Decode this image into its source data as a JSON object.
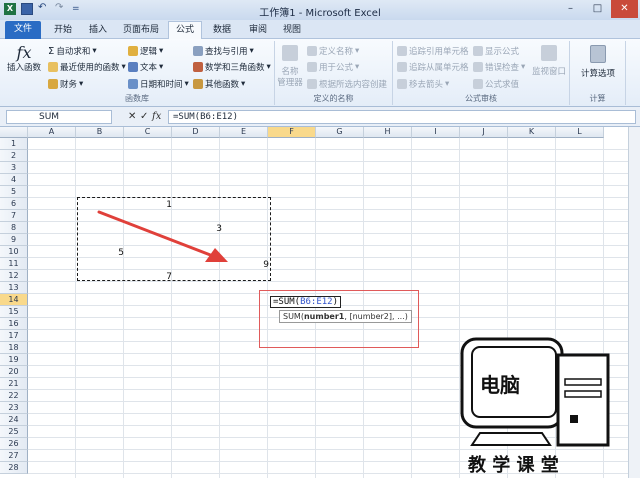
{
  "window": {
    "title": "工作簿1 - Microsoft Excel",
    "min": "–",
    "max": "□",
    "close": "✕",
    "quick_access": "="
  },
  "tabs": [
    "文件",
    "开始",
    "插入",
    "页面布局",
    "公式",
    "数据",
    "审阅",
    "视图"
  ],
  "ribbon": {
    "insert_function": "插入函数",
    "fx": "fx",
    "library": {
      "autosum": "自动求和",
      "recent": "最近使用的函数",
      "finance": "财务",
      "logic": "逻辑",
      "text": "文本",
      "datetime": "日期和时间",
      "lookup": "查找与引用",
      "math": "数学和三角函数",
      "other": "其他函数",
      "label": "函数库"
    },
    "names": {
      "manager_line1": "名称",
      "manager_line2": "管理器",
      "define": "定义名称",
      "use": "用于公式",
      "create": "根据所选内容创建",
      "label": "定义的名称"
    },
    "audit": {
      "trace_prec": "追踪引用单元格",
      "trace_dep": "追踪从属单元格",
      "remove": "移去箭头",
      "show": "显示公式",
      "check": "错误检查",
      "eval": "公式求值",
      "watch": "监视窗口",
      "label": "公式审核"
    },
    "calc": {
      "options": "计算选项",
      "label": "计算"
    }
  },
  "formula_bar": {
    "name_box": "SUM",
    "cancel": "✕",
    "enter": "✓",
    "fx": "fx",
    "formula": "=SUM(B6:E12)"
  },
  "columns": [
    "A",
    "B",
    "C",
    "D",
    "E",
    "F",
    "G",
    "H",
    "I",
    "J",
    "K",
    "L"
  ],
  "rows": [
    "1",
    "2",
    "3",
    "4",
    "5",
    "6",
    "7",
    "8",
    "9",
    "10",
    "11",
    "12",
    "13",
    "14",
    "15",
    "16",
    "17",
    "18",
    "19",
    "20",
    "21",
    "22",
    "23",
    "24",
    "25",
    "26",
    "27",
    "28"
  ],
  "cells": {
    "d6": "1",
    "e8": "3",
    "b10": "5",
    "e11": "9",
    "d12": "7"
  },
  "edit": {
    "prefix": "=SUM(",
    "ref": "B6:E12",
    "suffix": ")"
  },
  "tooltip": {
    "fn": "SUM(",
    "arg1": "number1",
    "rest": ", [number2], ...)"
  },
  "watermark": {
    "line1": "电脑",
    "line2": "教 学 课 堂"
  },
  "colors": {
    "file_tab": "#2a6cc4",
    "selection": "#f9d98b",
    "arrow": "#e0403a",
    "ref": "#3355cc"
  }
}
